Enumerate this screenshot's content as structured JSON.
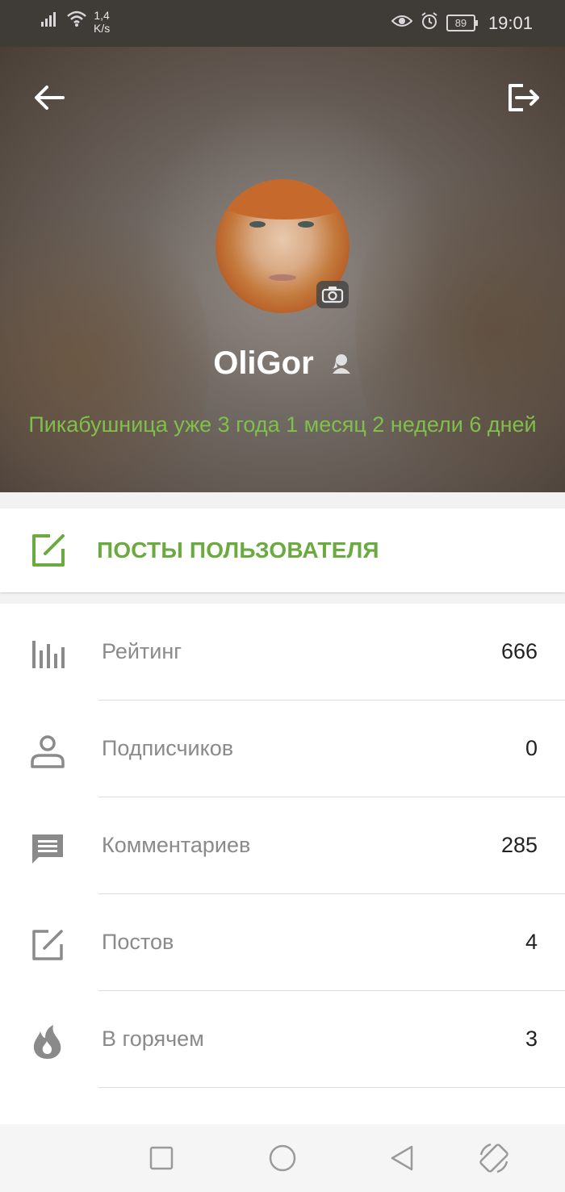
{
  "status_bar": {
    "net_speed_value": "1,4",
    "net_speed_unit": "K/s",
    "battery": "89",
    "time": "19:01"
  },
  "profile": {
    "username": "OliGor",
    "tenure": "Пикабушница уже 3 года 1 месяц 2 недели 6 дней"
  },
  "posts_button": {
    "label": "ПОСТЫ ПОЛЬЗОВАТЕЛЯ"
  },
  "stats": [
    {
      "icon": "bar-chart-icon",
      "label": "Рейтинг",
      "value": "666"
    },
    {
      "icon": "person-icon",
      "label": "Подписчиков",
      "value": "0"
    },
    {
      "icon": "comment-icon",
      "label": "Комментариев",
      "value": "285"
    },
    {
      "icon": "edit-icon",
      "label": "Постов",
      "value": "4"
    },
    {
      "icon": "fire-icon",
      "label": "В горячем",
      "value": "3"
    }
  ],
  "colors": {
    "accent_green": "#6aaa3f",
    "tenure_green": "#7fc04a",
    "icon_gray": "#8a8a8a"
  }
}
